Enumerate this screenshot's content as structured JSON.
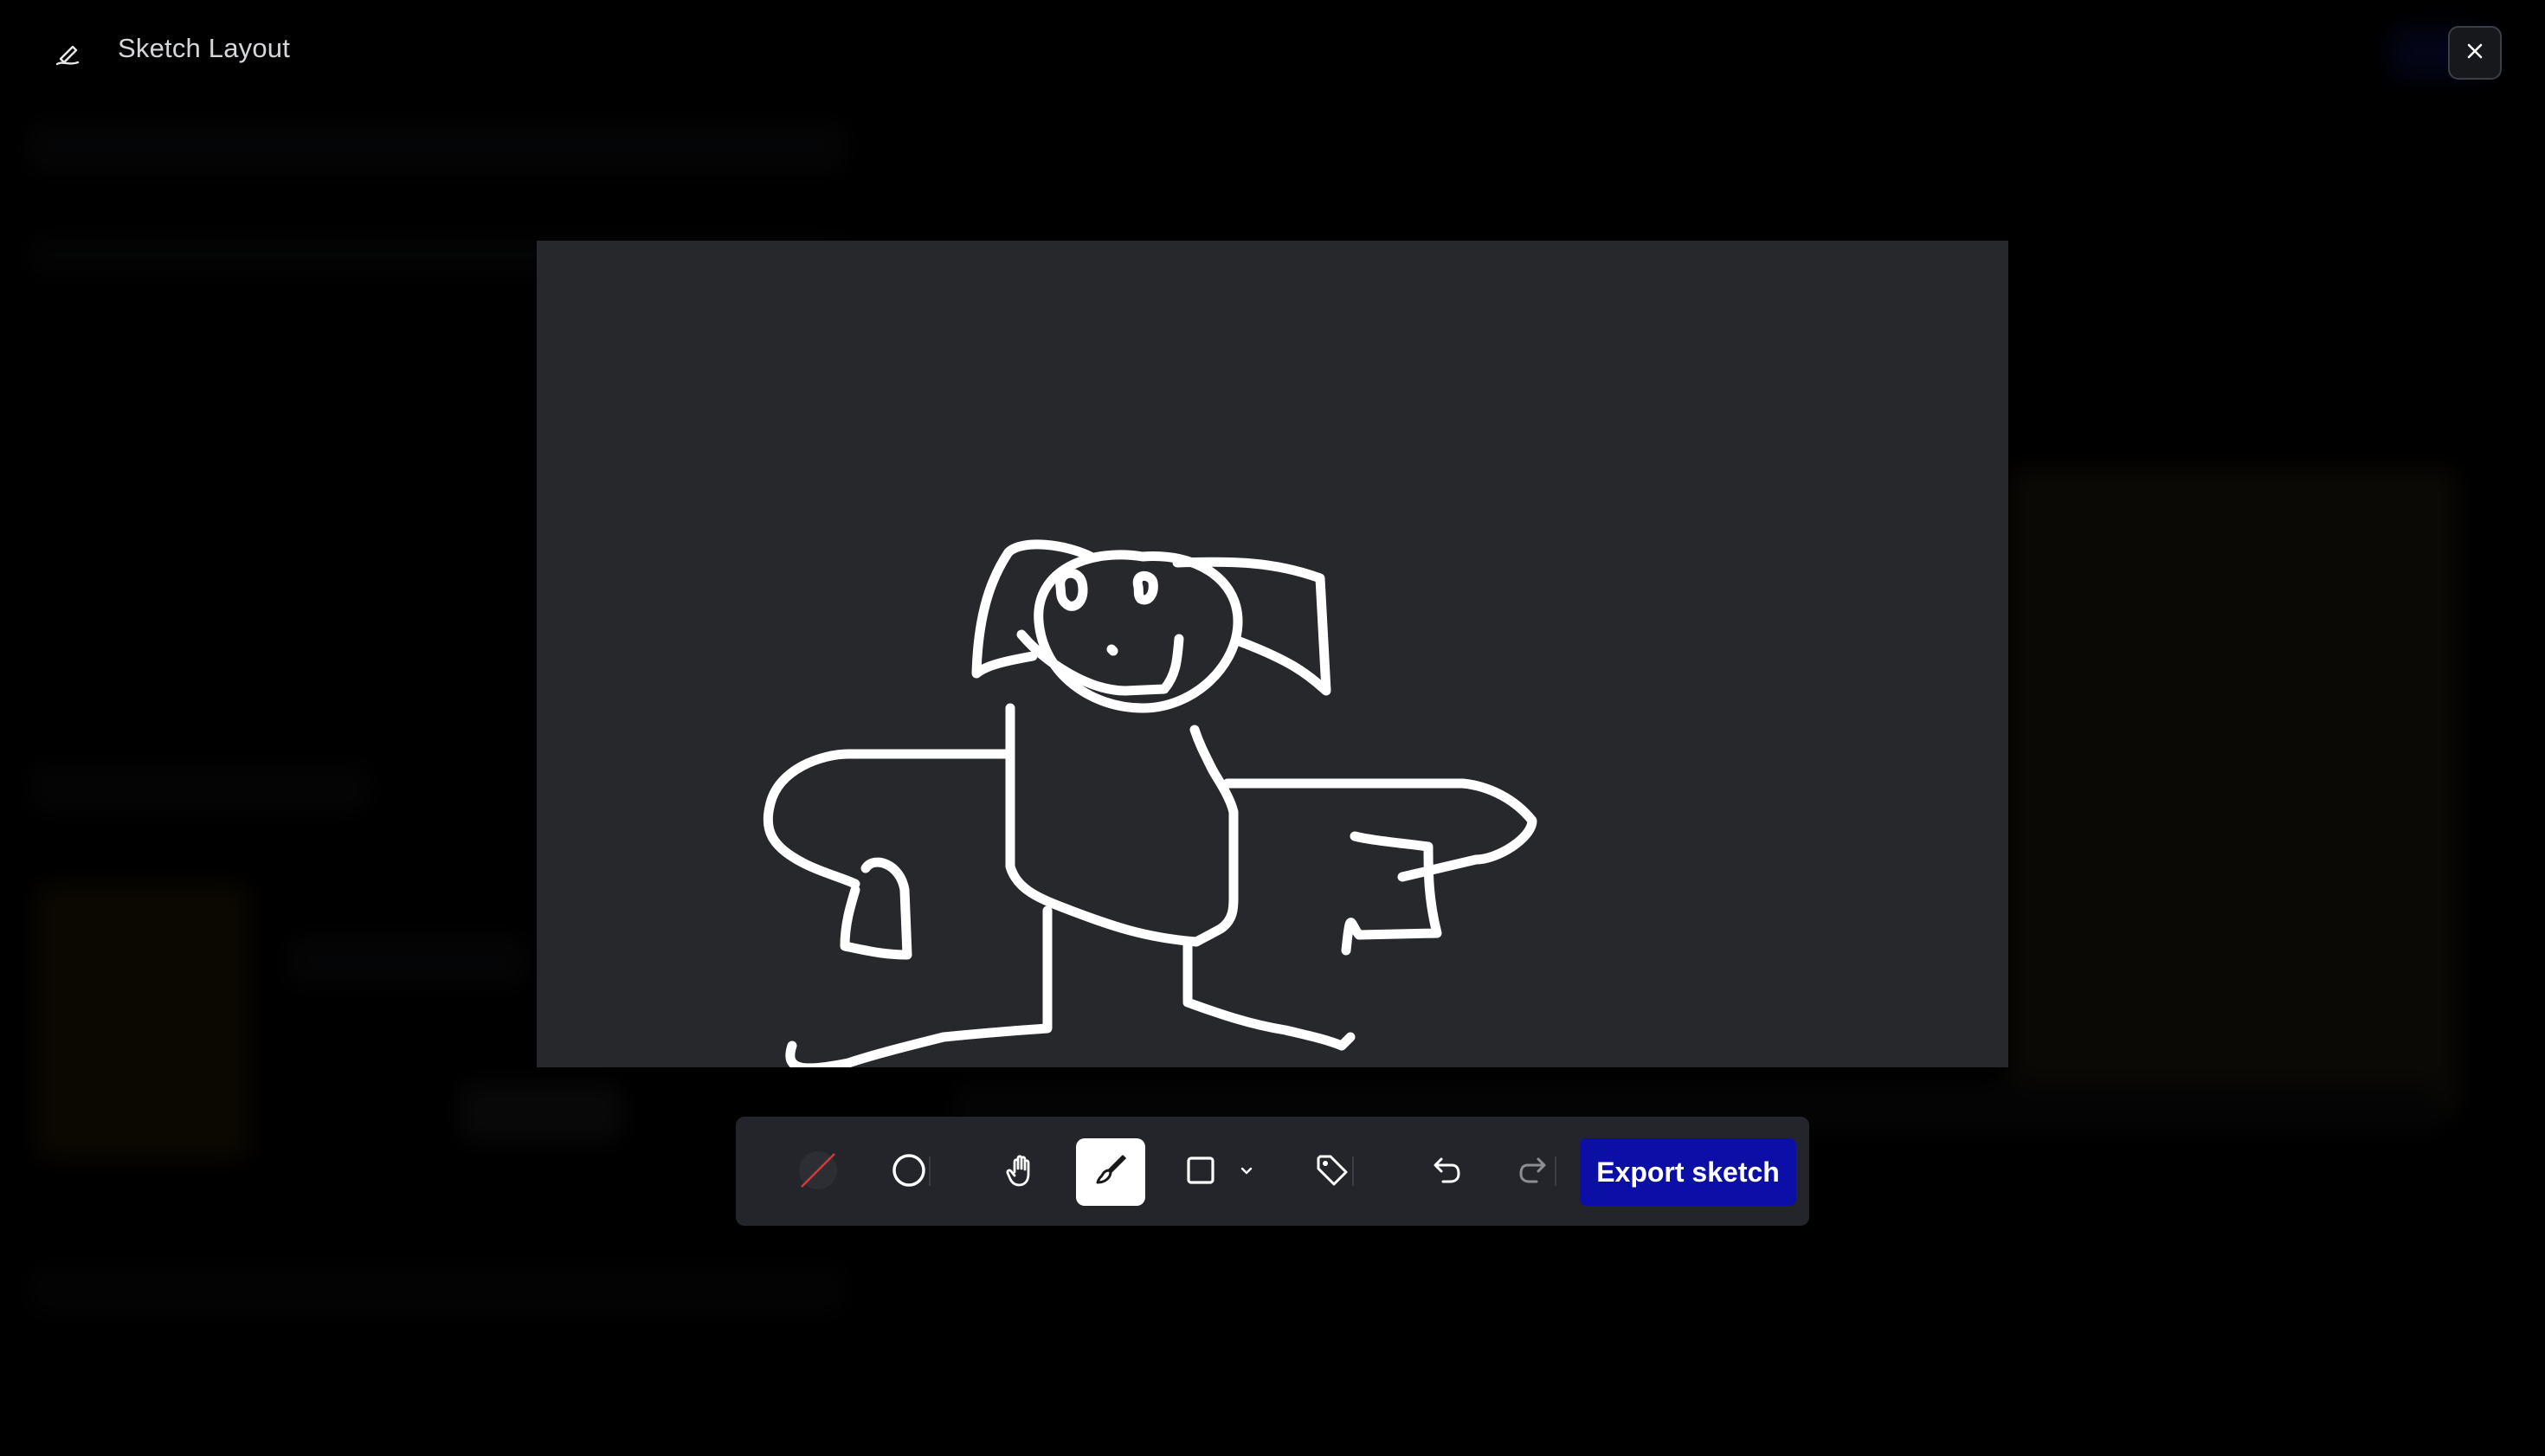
{
  "header": {
    "title": "Sketch Layout"
  },
  "toolbar": {
    "tools": [
      {
        "name": "no-color",
        "icon": "no-color-swatch-icon"
      },
      {
        "name": "circle",
        "icon": "circle-icon"
      },
      {
        "name": "pan",
        "icon": "hand-icon"
      },
      {
        "name": "brush",
        "icon": "brush-icon",
        "active": true
      },
      {
        "name": "rectangle",
        "icon": "rectangle-icon"
      },
      {
        "name": "shape-options",
        "icon": "chevron-down-icon"
      },
      {
        "name": "label",
        "icon": "tag-icon"
      },
      {
        "name": "undo",
        "icon": "undo-icon"
      },
      {
        "name": "redo",
        "icon": "redo-icon"
      }
    ],
    "export_label": "Export sketch"
  },
  "colors": {
    "canvas": "#27282c",
    "toolbar": "#23252a",
    "accent": "#0b0fa6",
    "stroke": "#ffffff"
  }
}
